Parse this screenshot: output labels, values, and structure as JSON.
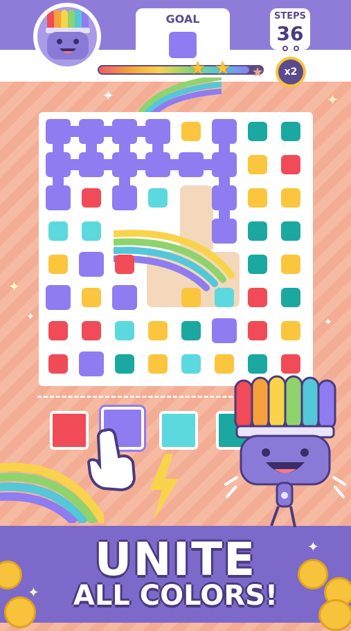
{
  "header": {
    "goal_label": "GOAL",
    "goal_color": "#8f7cf0",
    "steps_label": "STEPS",
    "steps_value": "36",
    "multiplier": "x2",
    "progress": 0.92,
    "stars": [
      {
        "state": "earned",
        "icon": "star-icon"
      },
      {
        "state": "earned",
        "icon": "star-icon"
      },
      {
        "state": "empty",
        "icon": "star-icon"
      }
    ]
  },
  "colors": {
    "purple": "#8f7cf0",
    "red": "#f04b56",
    "yellow": "#fbc63d",
    "teal": "#1aa8a0",
    "cyan": "#5bd9de",
    "board": "#ffffff",
    "bottom_band": "#7d69c9"
  },
  "board": {
    "rows": [
      [
        "P",
        "P",
        "P",
        "P",
        "Y",
        "P",
        "T",
        "T"
      ],
      [
        "P",
        "P",
        "P",
        "P",
        "P",
        "P",
        "Y",
        "R"
      ],
      [
        "P",
        "R",
        "P",
        "C",
        "-",
        "P",
        "Y",
        "Y"
      ],
      [
        "C",
        "C",
        "-",
        "-",
        "-",
        "P",
        "T",
        "T"
      ],
      [
        "Y",
        "P",
        "R",
        "-",
        "-",
        "-",
        "T",
        "Y"
      ],
      [
        "P",
        "Y",
        "P",
        "-",
        "Y",
        "C",
        "R",
        "T"
      ],
      [
        "R",
        "R",
        "C",
        "Y",
        "T",
        "P",
        "R",
        "Y"
      ],
      [
        "R",
        "P",
        "T",
        "Y",
        "C",
        "Y",
        "T",
        "R"
      ]
    ]
  },
  "palette": [
    {
      "color": "#f04b56",
      "selected": false
    },
    {
      "color": "#8f7cf0",
      "selected": true
    },
    {
      "color": "#5bd9de",
      "selected": false
    },
    {
      "color": "#1aa8a0",
      "selected": false
    }
  ],
  "headline": {
    "line1": "UNITE",
    "line2": "ALL COLORS!"
  },
  "icons": {
    "mascot": "paintbrush-mascot-icon",
    "hand": "pointing-hand-icon",
    "lightning": "lightning-bolt-icon"
  }
}
